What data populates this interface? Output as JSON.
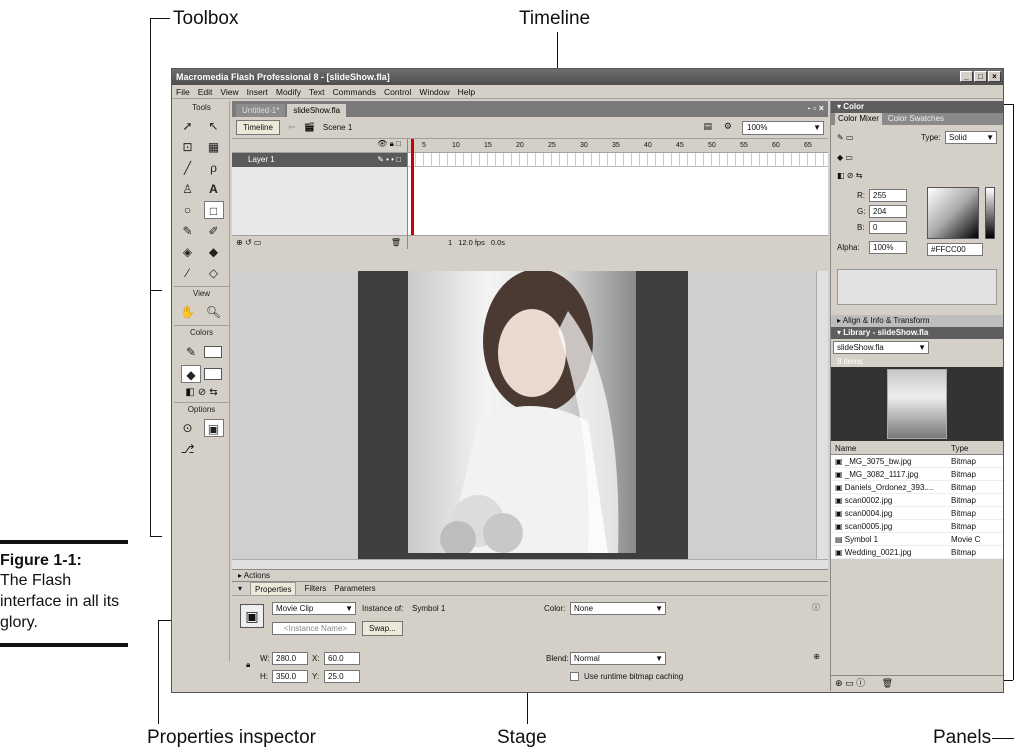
{
  "callouts": {
    "toolbox": "Toolbox",
    "timeline": "Timeline",
    "properties_inspector": "Properties inspector",
    "stage": "Stage",
    "panels": "Panels"
  },
  "figure": {
    "title": "Figure 1-1:",
    "caption": "The Flash interface in all its glory."
  },
  "app": {
    "title": "Macromedia Flash Professional 8 - [slideShow.fla]",
    "window_controls": [
      "_",
      "□",
      "×"
    ],
    "menu": [
      "File",
      "Edit",
      "View",
      "Insert",
      "Modify",
      "Text",
      "Commands",
      "Control",
      "Window",
      "Help"
    ]
  },
  "tools": {
    "header": "Tools",
    "view_label": "View",
    "colors_label": "Colors",
    "options_label": "Options"
  },
  "document": {
    "tabs": [
      "Untitled-1*",
      "slideShow.fla"
    ],
    "timeline_button": "Timeline",
    "scene": "Scene 1",
    "zoom": "100%",
    "layer_name": "Layer 1",
    "ruler_ticks": [
      "5",
      "10",
      "15",
      "20",
      "25",
      "30",
      "35",
      "40",
      "45",
      "50",
      "55",
      "60",
      "65"
    ],
    "frame": "1",
    "fps": "12.0 fps",
    "time": "0.0s"
  },
  "actions_panel": {
    "label": "Actions"
  },
  "properties": {
    "tabs": [
      "Properties",
      "Filters",
      "Parameters"
    ],
    "symbol_type": "Movie Clip",
    "instance_of_label": "Instance of:",
    "instance_of": "Symbol 1",
    "instance_name_placeholder": "<Instance Name>",
    "swap_button": "Swap...",
    "color_label": "Color:",
    "color_value": "None",
    "blend_label": "Blend:",
    "blend_value": "Normal",
    "cache_label": "Use runtime bitmap caching",
    "w_label": "W:",
    "w": "280.0",
    "x_label": "X:",
    "x": "60.0",
    "h_label": "H:",
    "h": "350.0",
    "y_label": "Y:",
    "y": "25.0"
  },
  "color_panel": {
    "title": "Color",
    "tabs": [
      "Color Mixer",
      "Color Swatches"
    ],
    "type_label": "Type:",
    "type_value": "Solid",
    "r_label": "R:",
    "r": "255",
    "g_label": "G:",
    "g": "204",
    "b_label": "B:",
    "b": "0",
    "alpha_label": "Alpha:",
    "alpha": "100%",
    "hex": "#FFCC00"
  },
  "align_panel": {
    "title": "Align & Info & Transform"
  },
  "library": {
    "title": "Library - slideShow.fla",
    "selected": "slideShow.fla",
    "count": "8 items",
    "columns": [
      "Name",
      "Type"
    ],
    "items": [
      {
        "name": "_MG_3075_bw.jpg",
        "type": "Bitmap"
      },
      {
        "name": "_MG_3082_1117.jpg",
        "type": "Bitmap"
      },
      {
        "name": "Daniels_Ordonez_393....",
        "type": "Bitmap"
      },
      {
        "name": "scan0002.jpg",
        "type": "Bitmap"
      },
      {
        "name": "scan0004.jpg",
        "type": "Bitmap"
      },
      {
        "name": "scan0005.jpg",
        "type": "Bitmap"
      },
      {
        "name": "Symbol 1",
        "type": "Movie C"
      },
      {
        "name": "Wedding_0021.jpg",
        "type": "Bitmap"
      }
    ]
  }
}
